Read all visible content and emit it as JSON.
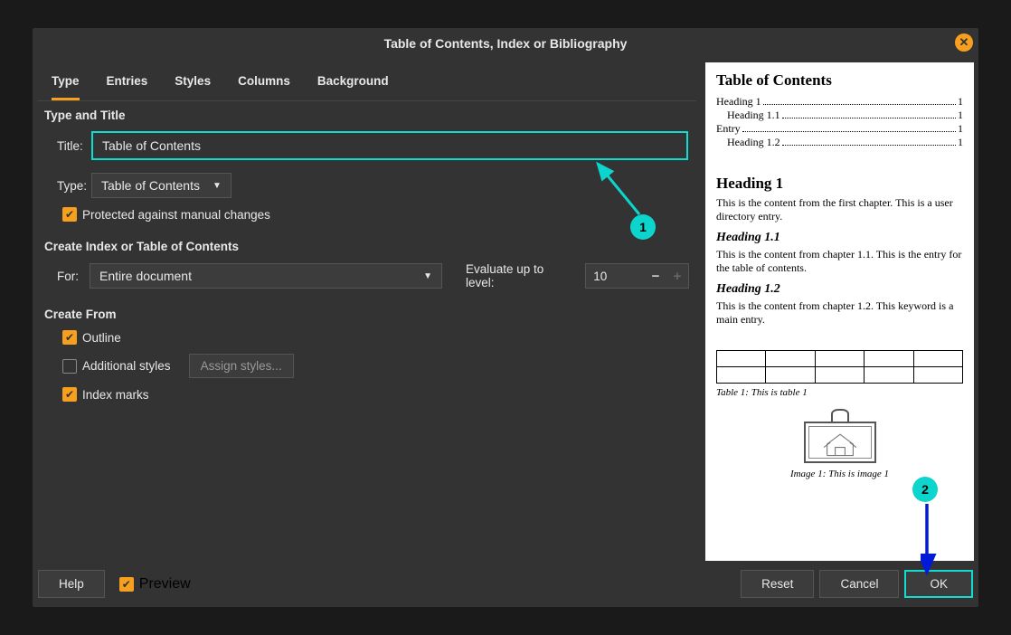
{
  "dialog": {
    "title": "Table of Contents, Index or Bibliography"
  },
  "tabs": {
    "type": "Type",
    "entries": "Entries",
    "styles": "Styles",
    "columns": "Columns",
    "background": "Background"
  },
  "sections": {
    "type_title": "Type and Title",
    "create_index": "Create Index or Table of Contents",
    "create_from": "Create From"
  },
  "labels": {
    "title": "Title:",
    "type": "Type:",
    "for": "For:",
    "evaluate": "Evaluate up to level:"
  },
  "values": {
    "title_input": "Table of Contents",
    "type_select": "Table of Contents",
    "for_select": "Entire document",
    "level": "10"
  },
  "checkboxes": {
    "protected": "Protected against manual changes",
    "outline": "Outline",
    "additional": "Additional styles",
    "index_marks": "Index marks"
  },
  "buttons": {
    "assign_styles": "Assign styles...",
    "help": "Help",
    "preview": "Preview",
    "reset": "Reset",
    "cancel": "Cancel",
    "ok": "OK"
  },
  "preview": {
    "toc_title": "Table of Contents",
    "toc": [
      {
        "label": "Heading 1",
        "page": "1",
        "indent": false
      },
      {
        "label": "Heading 1.1",
        "page": "1",
        "indent": true
      },
      {
        "label": "Entry",
        "page": "1",
        "indent": false
      },
      {
        "label": "Heading 1.2",
        "page": "1",
        "indent": true
      }
    ],
    "h1": "Heading 1",
    "p1": "This is the content from the first chapter. This is a user directory entry.",
    "h11": "Heading 1.1",
    "p11": "This is the content from chapter 1.1. This is the entry for the table of contents.",
    "h12": "Heading 1.2",
    "p12": "This is the content from chapter 1.2. This keyword is a main entry.",
    "table_caption": "Table 1: This is table 1",
    "image_caption": "Image 1: This is image 1"
  },
  "callouts": {
    "one": "1",
    "two": "2"
  }
}
